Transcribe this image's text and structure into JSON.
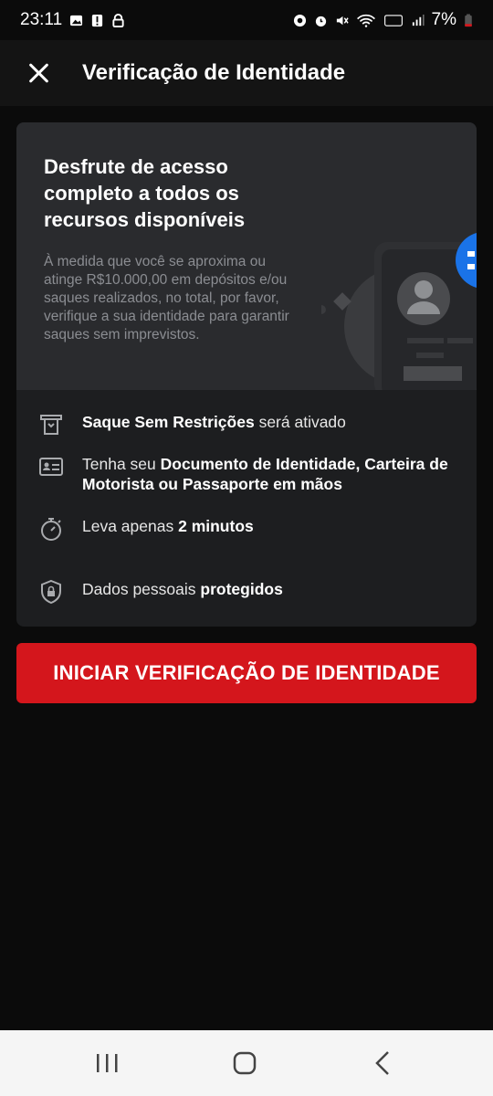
{
  "status": {
    "time": "23:11",
    "battery": "7%"
  },
  "header": {
    "title": "Verificação de Identidade"
  },
  "hero": {
    "heading": "Desfrute de acesso completo a todos os recursos disponíveis",
    "body": "À medida que você se aproxima ou atinge R$10.000,00 em depósitos e/ou saques realizados, no total, por favor, verifique a sua identidade para garantir saques sem imprevistos."
  },
  "features": {
    "item1_bold": "Saque Sem Restrições",
    "item1_rest": " será ativado",
    "item2_pre": "Tenha seu ",
    "item2_bold": "Documento de Identidade, Carteira de Motorista ou Passaporte em mãos",
    "item3_pre": "Leva apenas ",
    "item3_bold": "2 minutos",
    "item4_pre": "Dados pessoais ",
    "item4_bold": "protegidos"
  },
  "cta": {
    "label": "INICIAR VERIFICAÇÃO DE IDENTIDADE"
  },
  "colors": {
    "accent": "#d4161c",
    "badge": "#1a73e8"
  }
}
